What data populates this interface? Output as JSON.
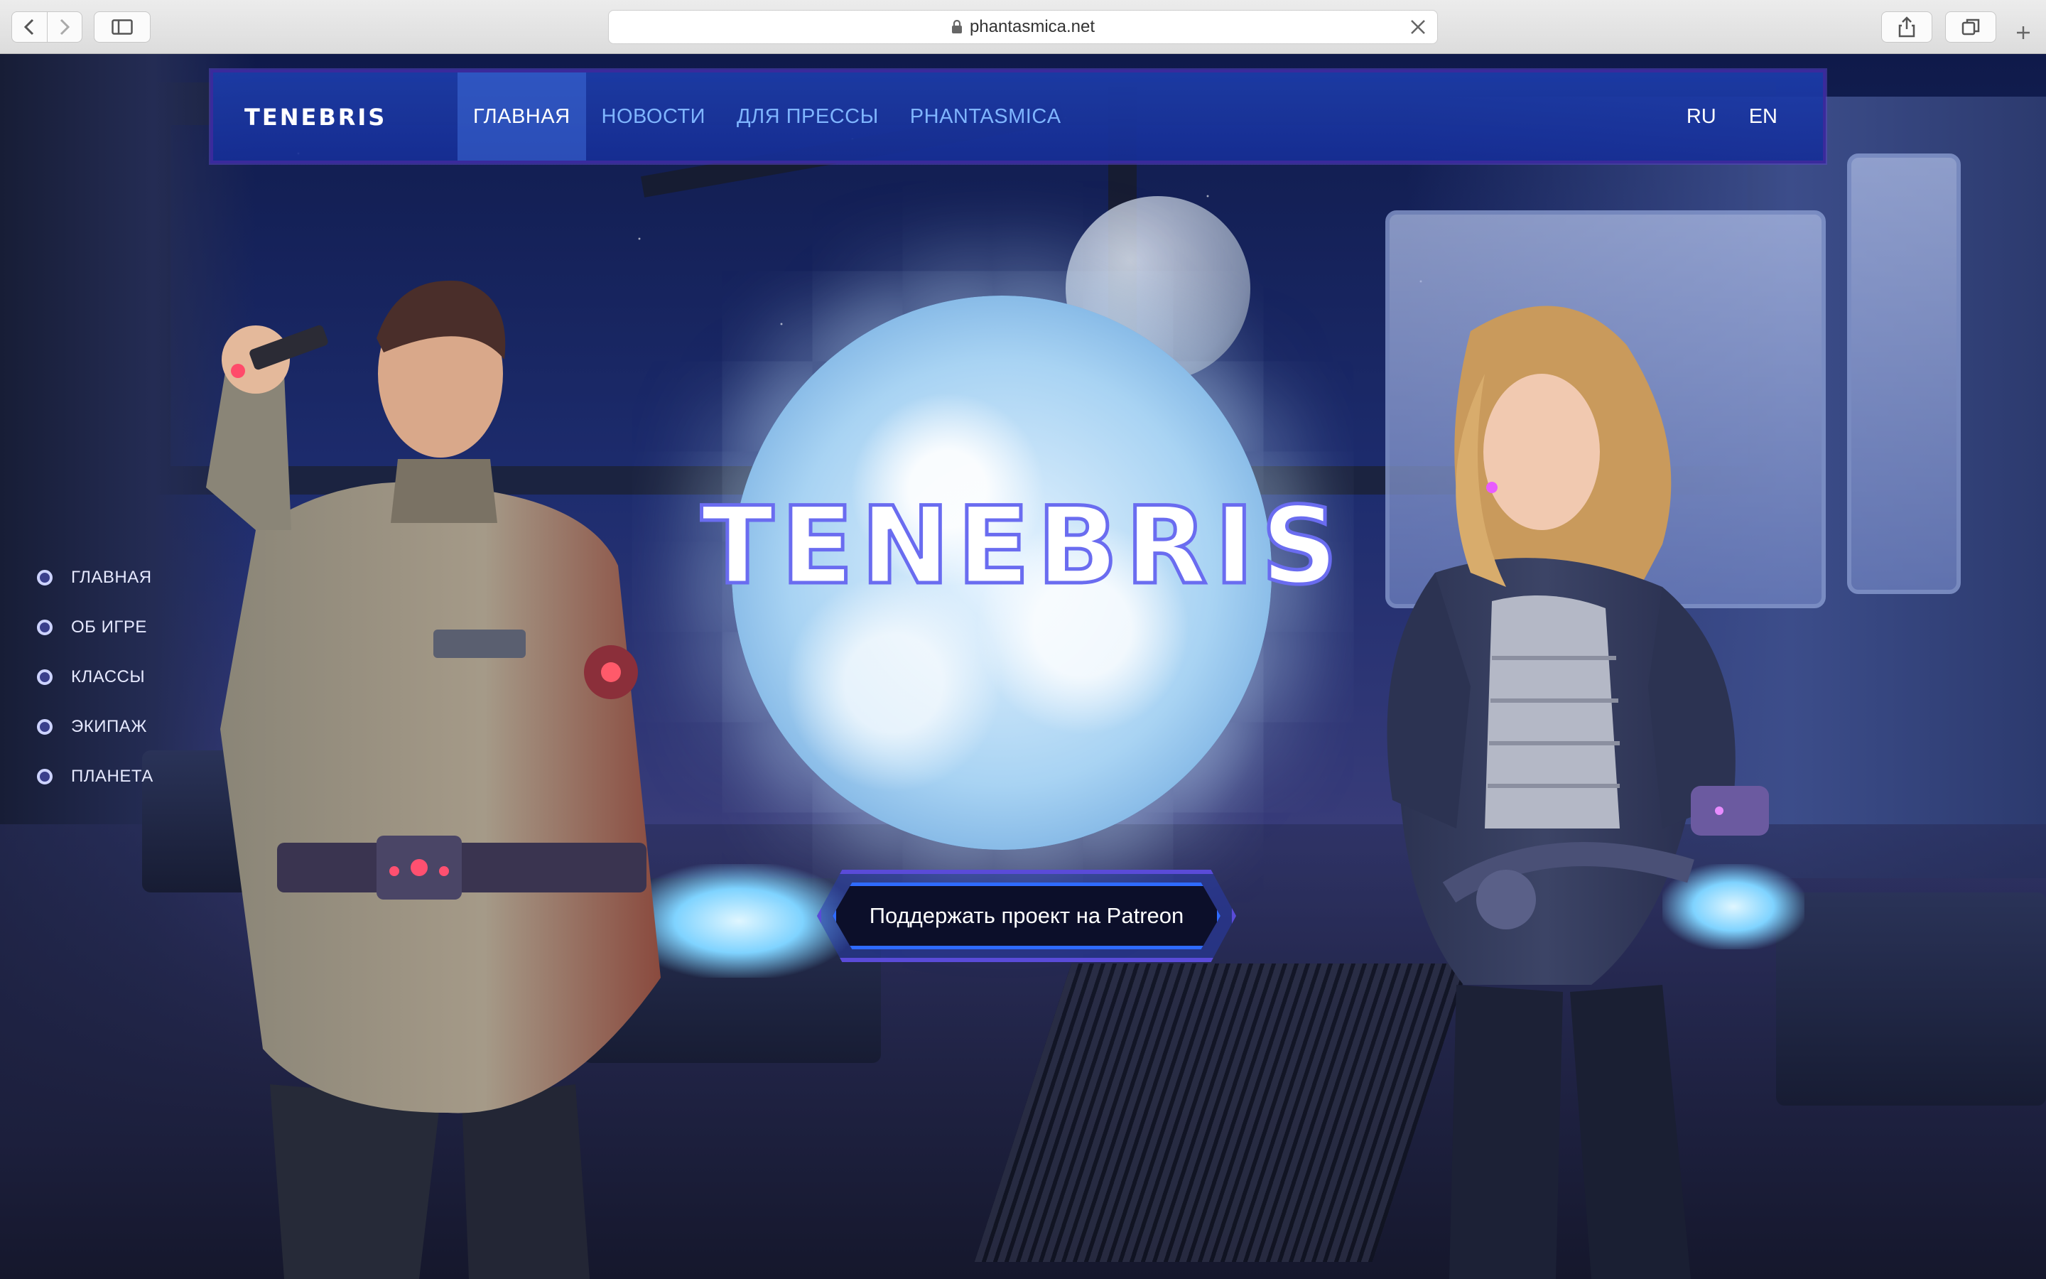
{
  "browser": {
    "url": "phantasmica.net"
  },
  "header": {
    "logo_text": "TENEBRIS",
    "nav": [
      {
        "label": "ГЛАВНАЯ",
        "active": true
      },
      {
        "label": "НОВОСТИ",
        "active": false
      },
      {
        "label": "ДЛЯ ПРЕССЫ",
        "active": false
      },
      {
        "label": "PHANTASMICA",
        "active": false
      }
    ],
    "languages": [
      "RU",
      "EN"
    ]
  },
  "side_nav": [
    {
      "label": "ГЛАВНАЯ"
    },
    {
      "label": "ОБ ИГРЕ"
    },
    {
      "label": "КЛАССЫ"
    },
    {
      "label": "ЭКИПАЖ"
    },
    {
      "label": "ПЛАНЕТА"
    }
  ],
  "hero": {
    "title": "TENEBRIS",
    "cta_label": "Поддержать проект на Patreon"
  },
  "colors": {
    "nav_bg": "#1c3caa",
    "nav_border": "#3a2a9c",
    "link": "#7fb5ff",
    "cta_border": "#2f6bff"
  },
  "icons": [
    "back-icon",
    "forward-icon",
    "sidebar-icon",
    "lock-icon",
    "clear-icon",
    "share-icon",
    "tabs-icon",
    "new-tab-icon"
  ]
}
